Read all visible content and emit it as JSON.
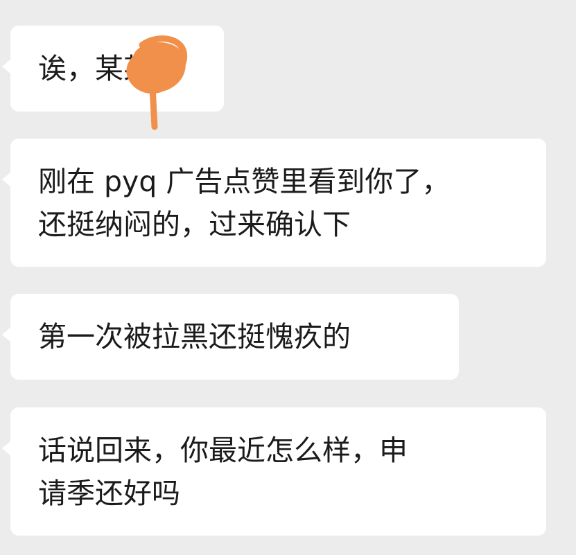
{
  "messages": [
    {
      "lines": [
        "诶，某某？"
      ]
    },
    {
      "lines": [
        "刚在 pyq 广告点赞里看到你了，",
        "还挺纳闷的，过来确认下"
      ]
    },
    {
      "lines": [
        "第一次被拉黑还挺愧疚的"
      ]
    },
    {
      "lines": [
        "话说回来，你最近怎么样，申",
        "请季还好吗"
      ]
    }
  ],
  "colors": {
    "background": "#ececec",
    "bubble": "#ffffff",
    "text": "#1b1b1b",
    "redaction_scribble": "#f0904a"
  },
  "icons": {
    "redaction": "orange-scribble-redaction"
  }
}
